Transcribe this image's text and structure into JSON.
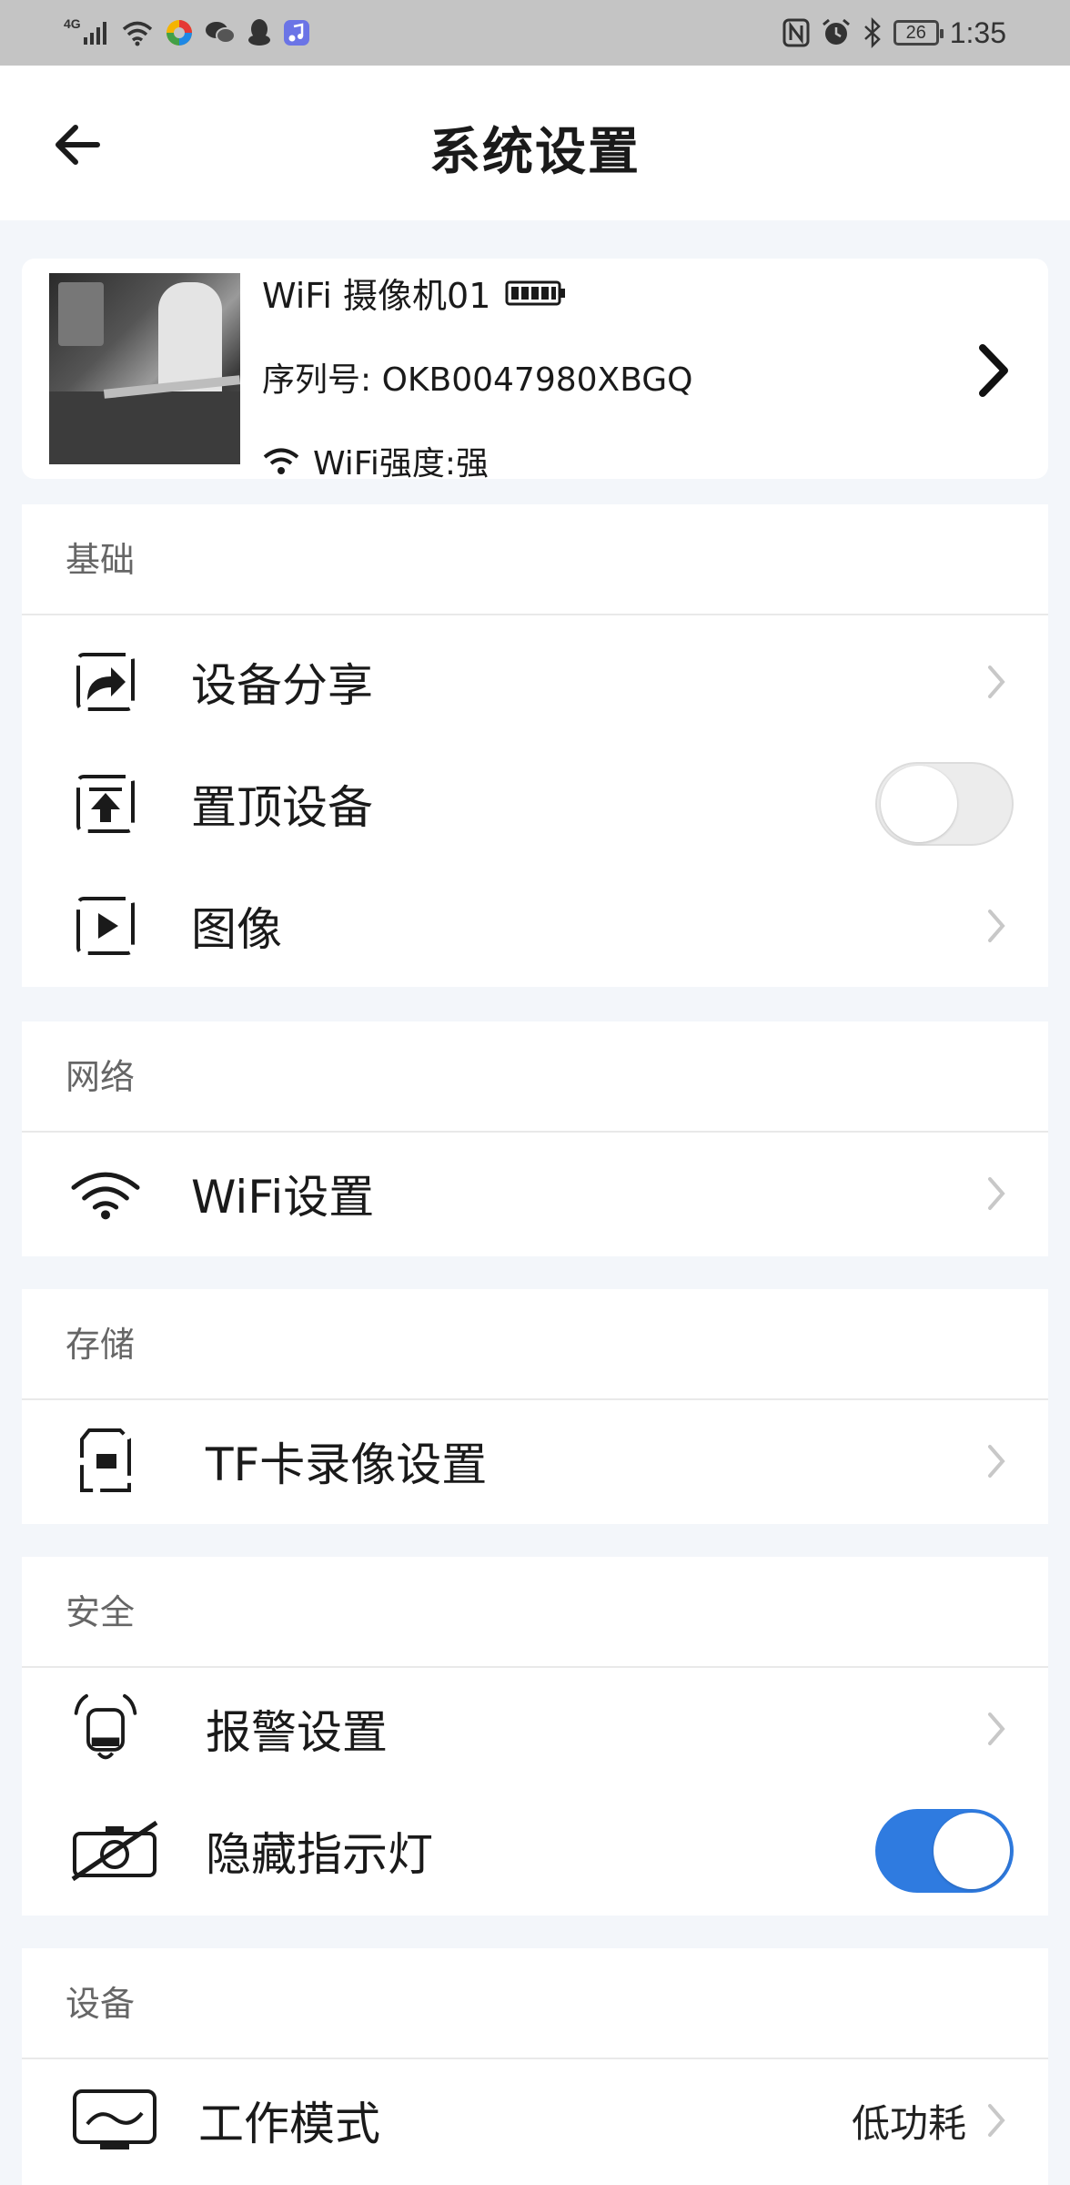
{
  "status_bar": {
    "network": "4G",
    "battery": "26",
    "time": "1:35",
    "left_icons": [
      "signal-icon",
      "wifi-icon",
      "colorful-app-icon",
      "wechat-icon",
      "qq-icon",
      "music-app-icon"
    ],
    "right_icons": [
      "nfc-icon",
      "alarm-icon",
      "bluetooth-icon",
      "battery-icon"
    ]
  },
  "header": {
    "title": "系统设置",
    "back_icon": "arrow-left-icon"
  },
  "device": {
    "name": "WiFi 摄像机01",
    "serial": "序列号: OKB0047980XBGQ",
    "wifi_strength": "WiFi强度:强",
    "battery_level": 1.0
  },
  "sections": {
    "basic": {
      "title": "基础",
      "items": [
        {
          "label": "设备分享",
          "icon": "share-icon",
          "type": "link"
        },
        {
          "label": "置顶设备",
          "icon": "pin-top-icon",
          "type": "toggle",
          "on": false
        },
        {
          "label": "图像",
          "icon": "image-icon",
          "type": "link"
        }
      ]
    },
    "network": {
      "title": "网络",
      "items": [
        {
          "label": "WiFi设置",
          "icon": "wifi-icon",
          "type": "link"
        }
      ]
    },
    "storage": {
      "title": "存储",
      "items": [
        {
          "label": "TF卡录像设置",
          "icon": "sd-card-icon",
          "type": "link"
        }
      ]
    },
    "security": {
      "title": "安全",
      "items": [
        {
          "label": "报警设置",
          "icon": "alarm-bell-icon",
          "type": "link"
        },
        {
          "label": "隐藏指示灯",
          "icon": "light-off-icon",
          "type": "toggle",
          "on": true
        }
      ]
    },
    "device": {
      "title": "设备",
      "items": [
        {
          "label": "工作模式",
          "icon": "monitor-icon",
          "type": "link",
          "value": "低功耗"
        }
      ]
    }
  },
  "colors": {
    "accent": "#2f7be0",
    "background": "#f3f6fa",
    "status_bar": "#c4c4c4"
  }
}
